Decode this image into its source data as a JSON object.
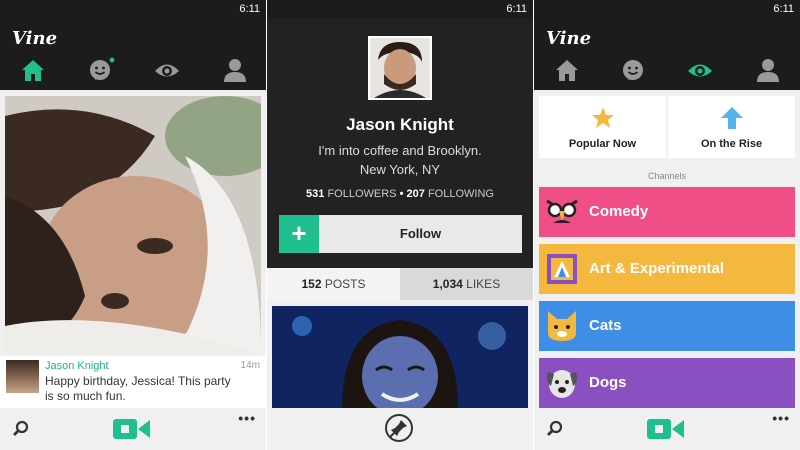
{
  "status_time": "6:11",
  "app_logo": "Vine",
  "colors": {
    "accent": "#1fbf8f",
    "topbar": "#1c1c1c",
    "comedy": "#ef4f86",
    "art": "#f5b83e",
    "cats": "#3f8ee6",
    "dogs": "#8a4fc0"
  },
  "nav_icons": [
    "home-icon",
    "activity-icon",
    "explore-icon",
    "profile-icon"
  ],
  "feed": {
    "post": {
      "author": "Jason Knight",
      "time": "14m",
      "caption": "Happy birthday, Jessica! This party is so much fun."
    },
    "bottom": {
      "search_icon": "search-icon",
      "record_icon": "camera-icon",
      "more": "•••"
    }
  },
  "profile": {
    "name": "Jason Knight",
    "bio_line1": "I'm into coffee and Brooklyn.",
    "bio_line2": "New York, NY",
    "followers_count": "531",
    "followers_label": "FOLLOWERS",
    "separator": "•",
    "following_count": "207",
    "following_label": "FOLLOWING",
    "follow_plus": "+",
    "follow_label": "Follow",
    "tabs": {
      "posts_count": "152",
      "posts_label": "POSTS",
      "likes_count": "1,034",
      "likes_label": "LIKES"
    },
    "bottom": {
      "pin_icon": "pin-icon"
    }
  },
  "explore": {
    "popular_label": "Popular Now",
    "rise_label": "On the Rise",
    "channels_header": "Channels",
    "channels": [
      {
        "name": "Comedy",
        "icon": "comedy-glasses-icon"
      },
      {
        "name": "Art & Experimental",
        "icon": "art-frame-icon"
      },
      {
        "name": "Cats",
        "icon": "cat-icon"
      },
      {
        "name": "Dogs",
        "icon": "dog-icon"
      }
    ],
    "bottom": {
      "more": "•••"
    }
  }
}
